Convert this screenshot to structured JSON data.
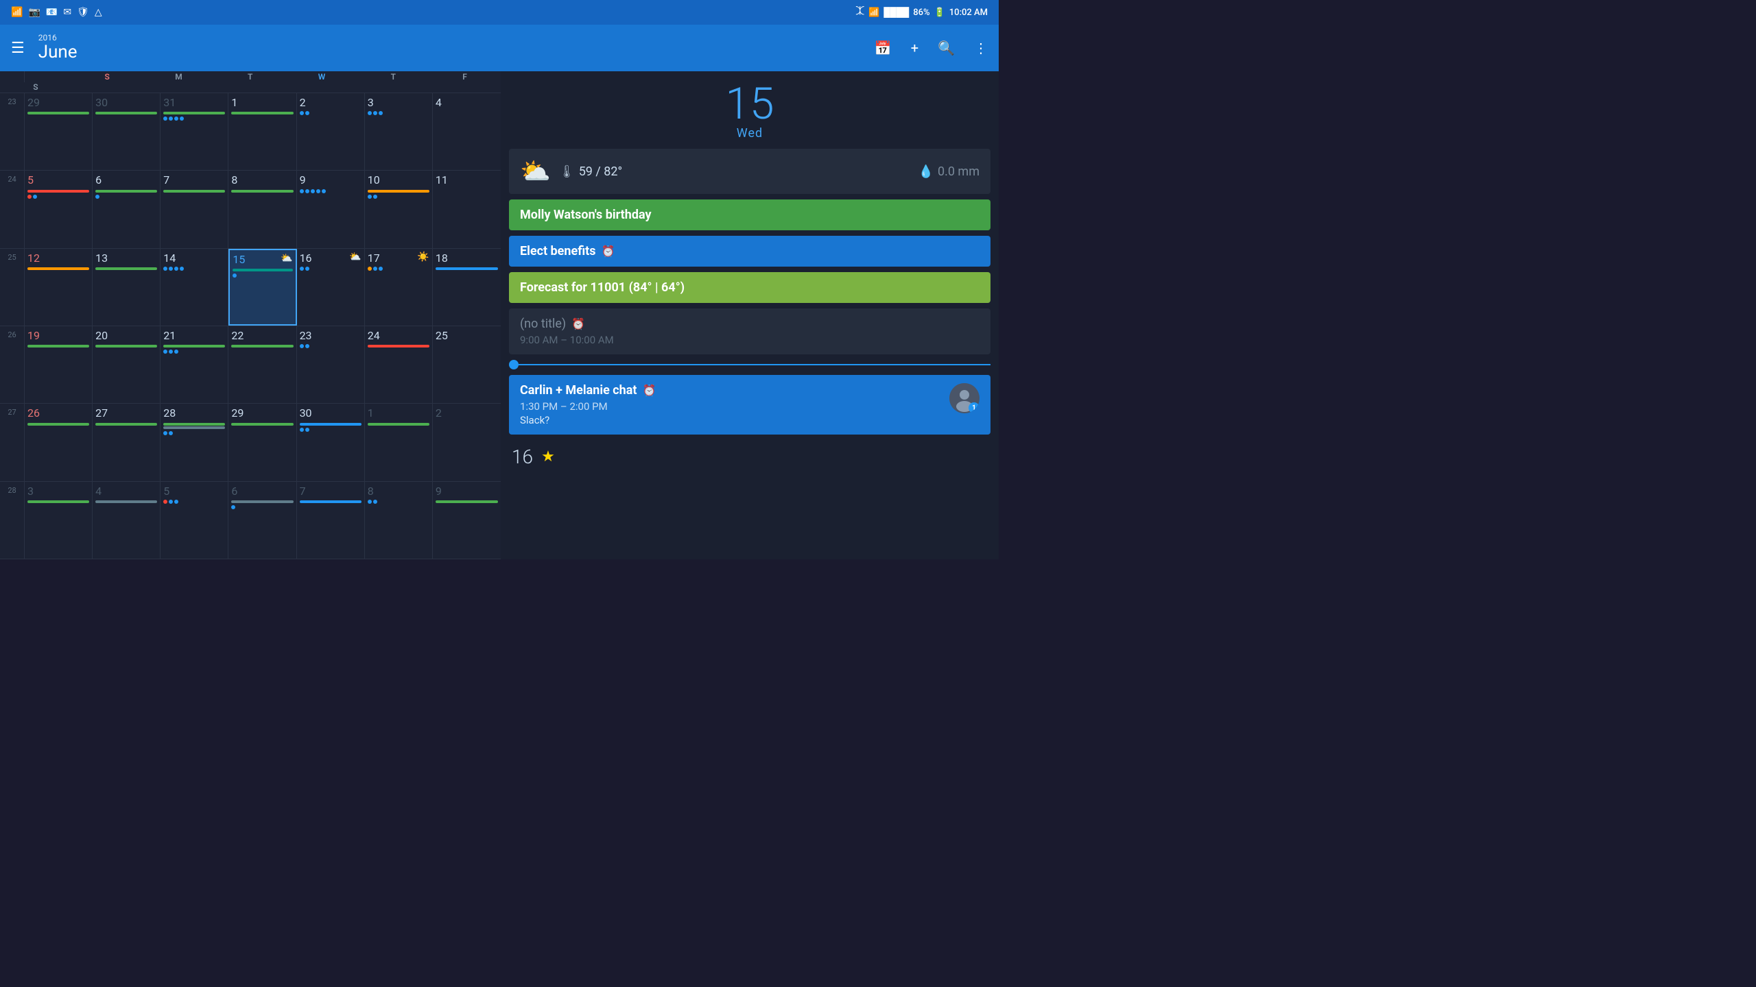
{
  "statusBar": {
    "icons_left": [
      "wifi",
      "image",
      "outlook",
      "email",
      "shield",
      "drive"
    ],
    "battery": "86%",
    "time": "10:02 AM",
    "signal": "●●●●"
  },
  "header": {
    "year": "2016",
    "month": "June",
    "hamburger": "≡",
    "icons": [
      "calendar-month",
      "add",
      "search",
      "more-vert"
    ]
  },
  "dayHeaders": [
    "S",
    "M",
    "T",
    "W",
    "T",
    "F",
    "S"
  ],
  "weeks": [
    {
      "weekNum": "23",
      "days": [
        {
          "num": "29",
          "type": "other-month sunday",
          "bars": [
            "green"
          ],
          "dots": []
        },
        {
          "num": "30",
          "type": "other-month",
          "bars": [
            "green"
          ],
          "dots": []
        },
        {
          "num": "31",
          "type": "other-month",
          "bars": [
            "green"
          ],
          "dots": [
            "blue",
            "blue",
            "blue",
            "blue"
          ]
        },
        {
          "num": "1",
          "type": "normal",
          "bars": [
            "green"
          ],
          "dots": []
        },
        {
          "num": "2",
          "type": "normal",
          "bars": [],
          "dots": [
            "blue",
            "blue"
          ]
        },
        {
          "num": "3",
          "type": "normal",
          "bars": [],
          "dots": [
            "blue",
            "blue",
            "blue"
          ]
        },
        {
          "num": "4",
          "type": "normal",
          "bars": [],
          "dots": []
        }
      ]
    },
    {
      "weekNum": "24",
      "days": [
        {
          "num": "5",
          "type": "sunday",
          "bars": [
            "red"
          ],
          "dots": [
            "red",
            "blue"
          ]
        },
        {
          "num": "6",
          "type": "normal",
          "bars": [
            "green"
          ],
          "dots": [
            "blue"
          ]
        },
        {
          "num": "7",
          "type": "normal",
          "bars": [
            "green"
          ],
          "dots": []
        },
        {
          "num": "8",
          "type": "normal",
          "bars": [
            "green"
          ],
          "dots": []
        },
        {
          "num": "9",
          "type": "normal",
          "bars": [],
          "dots": [
            "blue",
            "blue",
            "blue",
            "blue",
            "blue"
          ]
        },
        {
          "num": "10",
          "type": "normal",
          "bars": [
            "orange"
          ],
          "dots": [
            "blue",
            "blue"
          ]
        },
        {
          "num": "11",
          "type": "normal",
          "bars": [],
          "dots": []
        }
      ]
    },
    {
      "weekNum": "25",
      "days": [
        {
          "num": "12",
          "type": "sunday",
          "bars": [
            "orange"
          ],
          "dots": []
        },
        {
          "num": "13",
          "type": "normal",
          "bars": [
            "green"
          ],
          "dots": []
        },
        {
          "num": "14",
          "type": "normal",
          "bars": [],
          "dots": [
            "blue",
            "blue",
            "blue",
            "blue"
          ]
        },
        {
          "num": "15",
          "type": "today",
          "bars": [
            "teal"
          ],
          "dots": [
            "blue"
          ],
          "weather": "⛅"
        },
        {
          "num": "16",
          "type": "normal",
          "bars": [],
          "dots": [
            "blue",
            "blue"
          ],
          "weather": "⛅"
        },
        {
          "num": "17",
          "type": "normal",
          "bars": [],
          "dots": [
            "orange",
            "blue",
            "blue"
          ],
          "weather": "☀️"
        },
        {
          "num": "18",
          "type": "normal",
          "bars": [
            "blue"
          ],
          "dots": []
        }
      ]
    },
    {
      "weekNum": "26",
      "days": [
        {
          "num": "19",
          "type": "sunday",
          "bars": [
            "green"
          ],
          "dots": []
        },
        {
          "num": "20",
          "type": "normal",
          "bars": [
            "green"
          ],
          "dots": []
        },
        {
          "num": "21",
          "type": "normal",
          "bars": [
            "green"
          ],
          "dots": [
            "blue",
            "blue",
            "blue"
          ]
        },
        {
          "num": "22",
          "type": "normal",
          "bars": [
            "green"
          ],
          "dots": []
        },
        {
          "num": "23",
          "type": "normal",
          "bars": [],
          "dots": [
            "blue",
            "blue"
          ]
        },
        {
          "num": "24",
          "type": "normal",
          "bars": [
            "red"
          ],
          "dots": []
        },
        {
          "num": "25",
          "type": "normal",
          "bars": [],
          "dots": []
        }
      ]
    },
    {
      "weekNum": "27",
      "days": [
        {
          "num": "26",
          "type": "sunday",
          "bars": [
            "green"
          ],
          "dots": []
        },
        {
          "num": "27",
          "type": "normal",
          "bars": [
            "green"
          ],
          "dots": []
        },
        {
          "num": "28",
          "type": "normal",
          "bars": [
            "green",
            "gray"
          ],
          "dots": [
            "blue",
            "blue"
          ]
        },
        {
          "num": "29",
          "type": "normal",
          "bars": [
            "green"
          ],
          "dots": []
        },
        {
          "num": "30",
          "type": "normal",
          "bars": [
            "blue"
          ],
          "dots": [
            "blue",
            "blue"
          ]
        },
        {
          "num": "1",
          "type": "other-month",
          "bars": [
            "green"
          ],
          "dots": []
        },
        {
          "num": "2",
          "type": "other-month",
          "bars": [],
          "dots": []
        }
      ]
    },
    {
      "weekNum": "28",
      "days": [
        {
          "num": "3",
          "type": "other-month sunday",
          "bars": [
            "green"
          ],
          "dots": []
        },
        {
          "num": "4",
          "type": "other-month",
          "bars": [
            "gray"
          ],
          "dots": []
        },
        {
          "num": "5",
          "type": "other-month",
          "bars": [],
          "dots": [
            "red",
            "blue",
            "blue"
          ]
        },
        {
          "num": "6",
          "type": "other-month",
          "bars": [
            "gray"
          ],
          "dots": [
            "blue"
          ]
        },
        {
          "num": "7",
          "type": "other-month",
          "bars": [
            "blue"
          ],
          "dots": []
        },
        {
          "num": "8",
          "type": "other-month",
          "bars": [],
          "dots": [
            "blue",
            "blue"
          ]
        },
        {
          "num": "9",
          "type": "other-month",
          "bars": [
            "green"
          ],
          "dots": []
        }
      ]
    }
  ],
  "rightPanel": {
    "selectedDate": "15",
    "selectedWeekday": "Wed",
    "weather": {
      "icon": "⛅",
      "tempLow": "59",
      "tempHigh": "82",
      "unit": "°",
      "rain": "0.0 mm"
    },
    "events": [
      {
        "id": "birthday",
        "type": "birthday",
        "title": "Molly Watson's birthday",
        "time": "",
        "subtitle": ""
      },
      {
        "id": "benefits",
        "type": "benefits",
        "title": "Elect benefits",
        "hasAlarm": true,
        "time": "",
        "subtitle": ""
      },
      {
        "id": "forecast",
        "type": "forecast",
        "title": "Forecast for 11001 (84° | 64°)",
        "time": "",
        "subtitle": ""
      },
      {
        "id": "no-title",
        "type": "no-title",
        "title": "(no title)",
        "hasAlarm": true,
        "time": "9:00 AM – 10:00 AM",
        "subtitle": ""
      }
    ],
    "timeMarker": true,
    "chatEvent": {
      "title": "Carlin + Melanie chat",
      "hasAlarm": true,
      "time": "1:30 PM – 2:00 PM",
      "subtitle": "Slack?",
      "avatarBadge": "1"
    },
    "nextDay": {
      "num": "16",
      "starIcon": "★"
    }
  }
}
